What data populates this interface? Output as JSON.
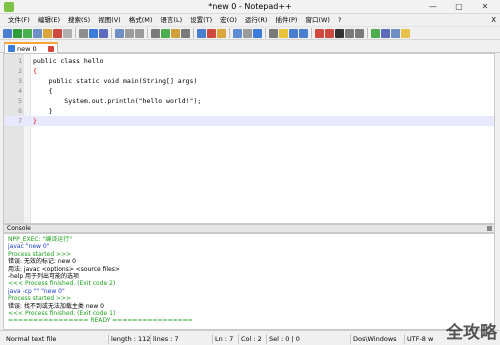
{
  "window": {
    "title": "*new  0 - Notepad++",
    "min": "—",
    "max": "▢",
    "close": "✕"
  },
  "menu": [
    "文件(F)",
    "编辑(E)",
    "搜索(S)",
    "视图(V)",
    "格式(M)",
    "语言(L)",
    "设置(T)",
    "宏(O)",
    "运行(R)",
    "插件(P)",
    "窗口(W)",
    "?"
  ],
  "menu_close": "X",
  "toolbar_colors": [
    "#4a7fcf",
    "#2f9c3a",
    "#4bae4f",
    "#6d8fc4",
    "#d9a63b",
    "#cf4a3e",
    "#b0b0b0",
    "#8e8e8e",
    "#3b7bd9",
    "#5d6bbd",
    "#6d8fc4",
    "#9b9b9b",
    "#9b9b9b",
    "#7a7a7a",
    "#4bae4f",
    "#cfa03b",
    "#7a7a7a",
    "#4a7fcf",
    "#cf4a3e",
    "#d9a63b",
    "#5e8ed6",
    "#9b9b9b",
    "#3b7bd9",
    "#7a7a7a",
    "#e7c33a",
    "#4a7fcf",
    "#4a7fcf",
    "#cf4a3e",
    "#cf4a3e",
    "#333333",
    "#7a7a7a",
    "#7a7a7a",
    "#4bae4f",
    "#5d6bbd",
    "#6d8fc4",
    "#e8c04a"
  ],
  "tab": {
    "label": "new  0"
  },
  "editor": {
    "lines": [
      {
        "num": "1",
        "text": "public class hello"
      },
      {
        "num": "2",
        "text": "{"
      },
      {
        "num": "3",
        "text": "    public static void main(String[] args)"
      },
      {
        "num": "4",
        "text": "    {"
      },
      {
        "num": "5",
        "text": "        System.out.println(\"hello world!\");"
      },
      {
        "num": "6",
        "text": "    }"
      },
      {
        "num": "7",
        "text": "}"
      }
    ]
  },
  "console": {
    "title": "Console",
    "lines": [
      {
        "text": "NPP_EXEC: \"编译运行\"",
        "color": "green"
      },
      {
        "text": "javac \"new  0\"",
        "color": "blue"
      },
      {
        "text": "Process started >>>",
        "color": "green"
      },
      {
        "text": "错误: 无效的标记: new  0",
        "color": "black"
      },
      {
        "text": "用法: javac <options> <source files>",
        "color": "black"
      },
      {
        "text": "-help 用于列出可能的选项",
        "color": "black"
      },
      {
        "text": "<<< Process finished. (Exit code 2)",
        "color": "green"
      },
      {
        "text": "java -cp \"\" \"new  0\"",
        "color": "blue"
      },
      {
        "text": "Process started >>>",
        "color": "green"
      },
      {
        "text": "错误: 找不到或无法加载主类 new  0",
        "color": "black"
      },
      {
        "text": "<<< Process finished. (Exit code 1)",
        "color": "green"
      },
      {
        "text": "================ READY ================",
        "color": "green"
      }
    ]
  },
  "status": {
    "type": "Normal text file",
    "length": "length : 112",
    "lines": "lines : 7",
    "ln": "Ln : 7",
    "col": "Col : 2",
    "sel": "Sel : 0 | 0",
    "eol": "Dos\\Windows",
    "encoding": "UTF-8 w"
  },
  "watermark": "全攻略"
}
